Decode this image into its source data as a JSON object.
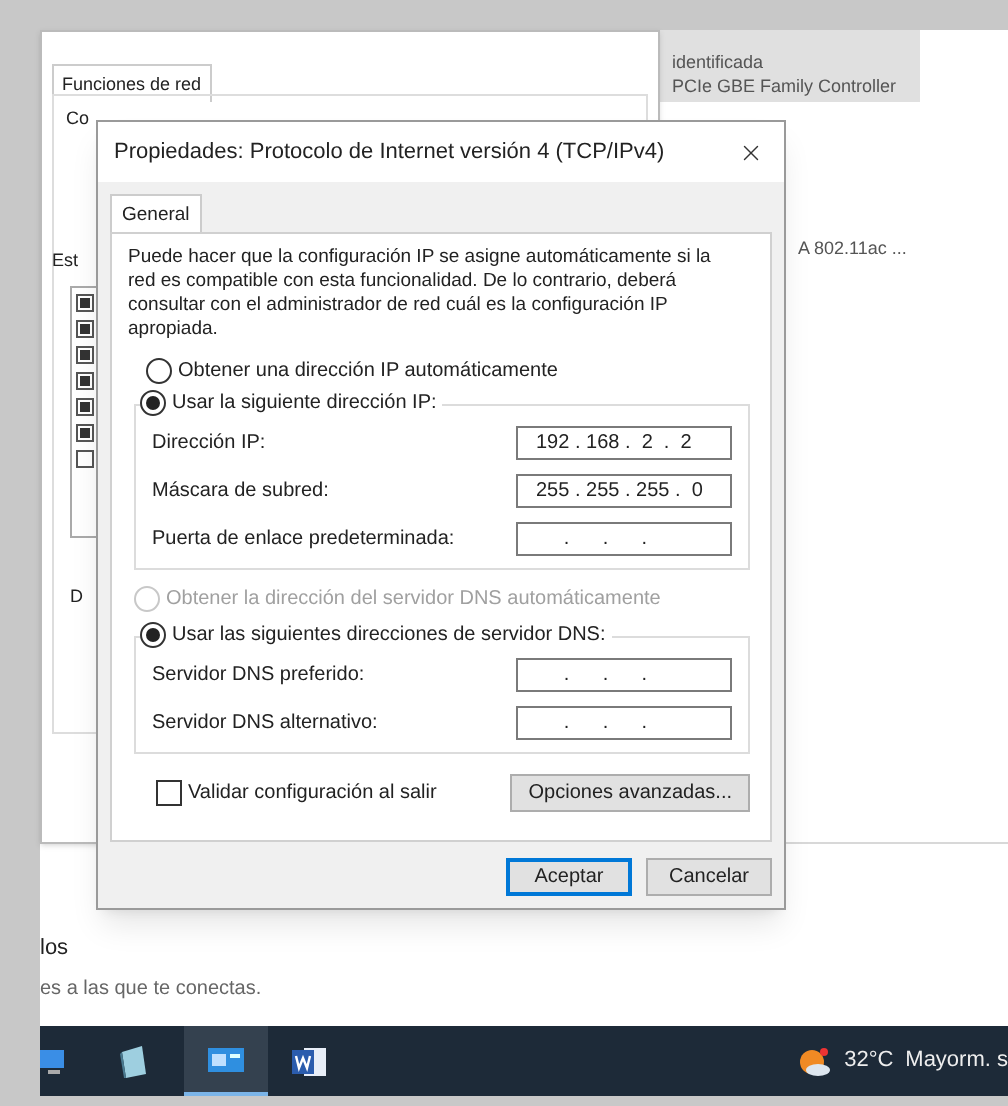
{
  "settings_page": {
    "adapter_lines": [
      "identificada",
      "PCIe GBE Family Controller"
    ],
    "adapter2_line": "A 802.11ac ...",
    "footer_title": "los",
    "footer_text": "es a las que te conectas."
  },
  "background_window": {
    "tab": {
      "label": "Funciones de red",
      "selected": true
    },
    "cut_label_1": "Co",
    "cut_label_2": "Est",
    "cut_label_3": "D",
    "list_checks": [
      true,
      true,
      true,
      true,
      true,
      true,
      false
    ]
  },
  "dialog": {
    "title": "Propiedades: Protocolo de Internet versión 4 (TCP/IPv4)",
    "tabs": [
      {
        "label": "General",
        "selected": true
      }
    ],
    "description": "Puede hacer que la configuración IP se asigne automáticamente si la red es compatible con esta funcionalidad. De lo contrario, deberá consultar con el administrador de red cuál es la configuración IP apropiada.",
    "ip_auto": {
      "label": "Obtener una dirección IP automáticamente",
      "selected": false,
      "disabled": false
    },
    "ip_manual": {
      "label": "Usar la siguiente dirección IP:",
      "selected": true,
      "disabled": false,
      "fields": [
        {
          "label": "Dirección IP:",
          "value": "192 . 168 .  2  .  2"
        },
        {
          "label": "Máscara de subred:",
          "value": "255 . 255 . 255 .  0"
        },
        {
          "label": "Puerta de enlace predeterminada:",
          "value": "     .      .      ."
        }
      ]
    },
    "dns_auto": {
      "label": "Obtener la dirección del servidor DNS automáticamente",
      "selected": false,
      "disabled": true
    },
    "dns_manual": {
      "label": "Usar las siguientes direcciones de servidor DNS:",
      "selected": true,
      "disabled": false,
      "fields": [
        {
          "label": "Servidor DNS preferido:",
          "value": "     .      .      ."
        },
        {
          "label": "Servidor DNS alternativo:",
          "value": "     .      .      ."
        }
      ]
    },
    "validate": {
      "label": "Validar configuración al salir",
      "checked": false
    },
    "advanced_button": "Opciones avanzadas...",
    "ok_button": "Aceptar",
    "cancel_button": "Cancelar"
  },
  "taskbar": {
    "weather": {
      "temperature": "32°C",
      "condition": "Mayorm. s"
    }
  }
}
